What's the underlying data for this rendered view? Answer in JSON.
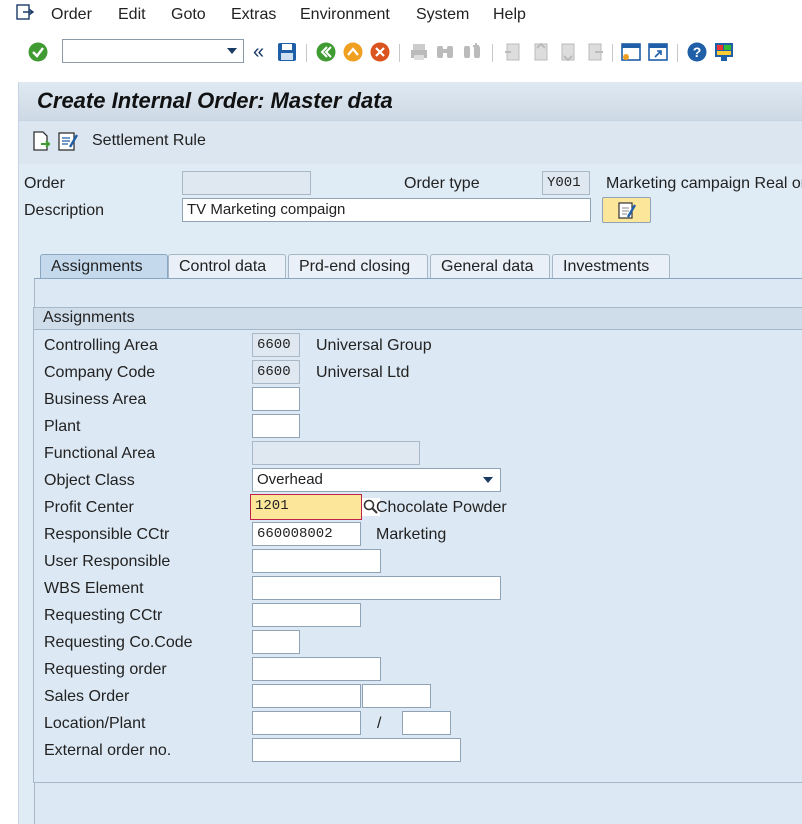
{
  "menu": {
    "items": [
      "Order",
      "Edit",
      "Goto",
      "Extras",
      "Environment",
      "System",
      "Help"
    ]
  },
  "toolbar": {
    "command_value": ""
  },
  "header": {
    "title": "Create Internal Order: Master data"
  },
  "app_toolbar": {
    "settlement_label": "Settlement Rule"
  },
  "order": {
    "order_label": "Order",
    "order_value": "",
    "order_type_label": "Order type",
    "order_type_value": "Y001",
    "order_type_text": "Marketing campaign Real or",
    "description_label": "Description",
    "description_value": "TV Marketing compaign"
  },
  "tabs": [
    "Assignments",
    "Control data",
    "Prd-end closing",
    "General data",
    "Investments"
  ],
  "assignments": {
    "group_title": "Assignments",
    "controlling_area_label": "Controlling Area",
    "controlling_area_value": "6600",
    "controlling_area_text": "Universal Group",
    "company_code_label": "Company Code",
    "company_code_value": "6600",
    "company_code_text": "Universal Ltd",
    "business_area_label": "Business Area",
    "business_area_value": "",
    "plant_label": "Plant",
    "plant_value": "",
    "functional_area_label": "Functional Area",
    "functional_area_value": "",
    "object_class_label": "Object Class",
    "object_class_value": "Overhead",
    "profit_center_label": "Profit Center",
    "profit_center_value": "1201",
    "profit_center_text": "Chocolate Powder",
    "responsible_cctr_label": "Responsible CCtr",
    "responsible_cctr_value": "660008002",
    "responsible_cctr_text": "Marketing",
    "user_responsible_label": "User Responsible",
    "user_responsible_value": "",
    "wbs_element_label": "WBS Element",
    "wbs_element_value": "",
    "requesting_cctr_label": "Requesting CCtr",
    "requesting_cctr_value": "",
    "requesting_cocode_label": "Requesting Co.Code",
    "requesting_cocode_value": "",
    "requesting_order_label": "Requesting order",
    "requesting_order_value": "",
    "sales_order_label": "Sales Order",
    "sales_order_value": "",
    "sales_order_item_value": "",
    "location_plant_label": "Location/Plant",
    "location_value": "",
    "location_sep": "/",
    "plant2_value": "",
    "external_order_label": "External order no.",
    "external_order_value": ""
  },
  "colors": {
    "accent": "#1a3a66",
    "highlight": "#fbe69a",
    "panel": "#dce8f3"
  }
}
